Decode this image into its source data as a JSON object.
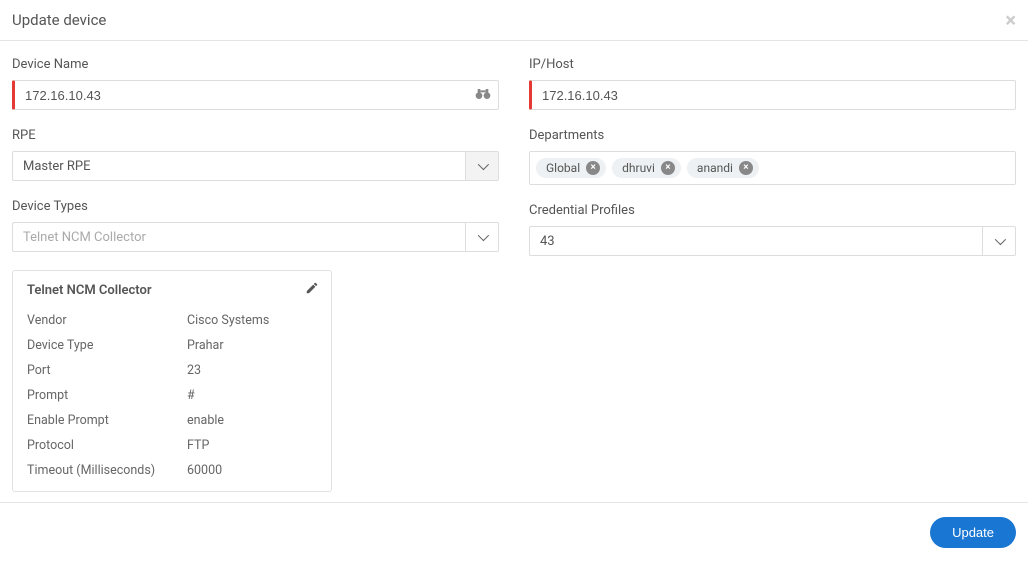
{
  "header": {
    "title": "Update device"
  },
  "left": {
    "deviceName": {
      "label": "Device Name",
      "value": "172.16.10.43"
    },
    "rpe": {
      "label": "RPE",
      "value": "Master RPE"
    },
    "deviceTypes": {
      "label": "Device Types",
      "placeholder": "Telnet NCM Collector"
    }
  },
  "right": {
    "ipHost": {
      "label": "IP/Host",
      "value": "172.16.10.43"
    },
    "departments": {
      "label": "Departments",
      "tags": [
        "Global",
        "dhruvi",
        "anandi"
      ]
    },
    "credProfiles": {
      "label": "Credential Profiles",
      "value": "43"
    }
  },
  "card": {
    "title": "Telnet NCM Collector",
    "rows": [
      {
        "k": "Vendor",
        "v": "Cisco Systems"
      },
      {
        "k": "Device Type",
        "v": "Prahar"
      },
      {
        "k": "Port",
        "v": "23"
      },
      {
        "k": "Prompt",
        "v": "#"
      },
      {
        "k": "Enable Prompt",
        "v": "enable"
      },
      {
        "k": "Protocol",
        "v": "FTP"
      },
      {
        "k": "Timeout (Milliseconds)",
        "v": "60000"
      }
    ]
  },
  "footer": {
    "update": "Update"
  }
}
